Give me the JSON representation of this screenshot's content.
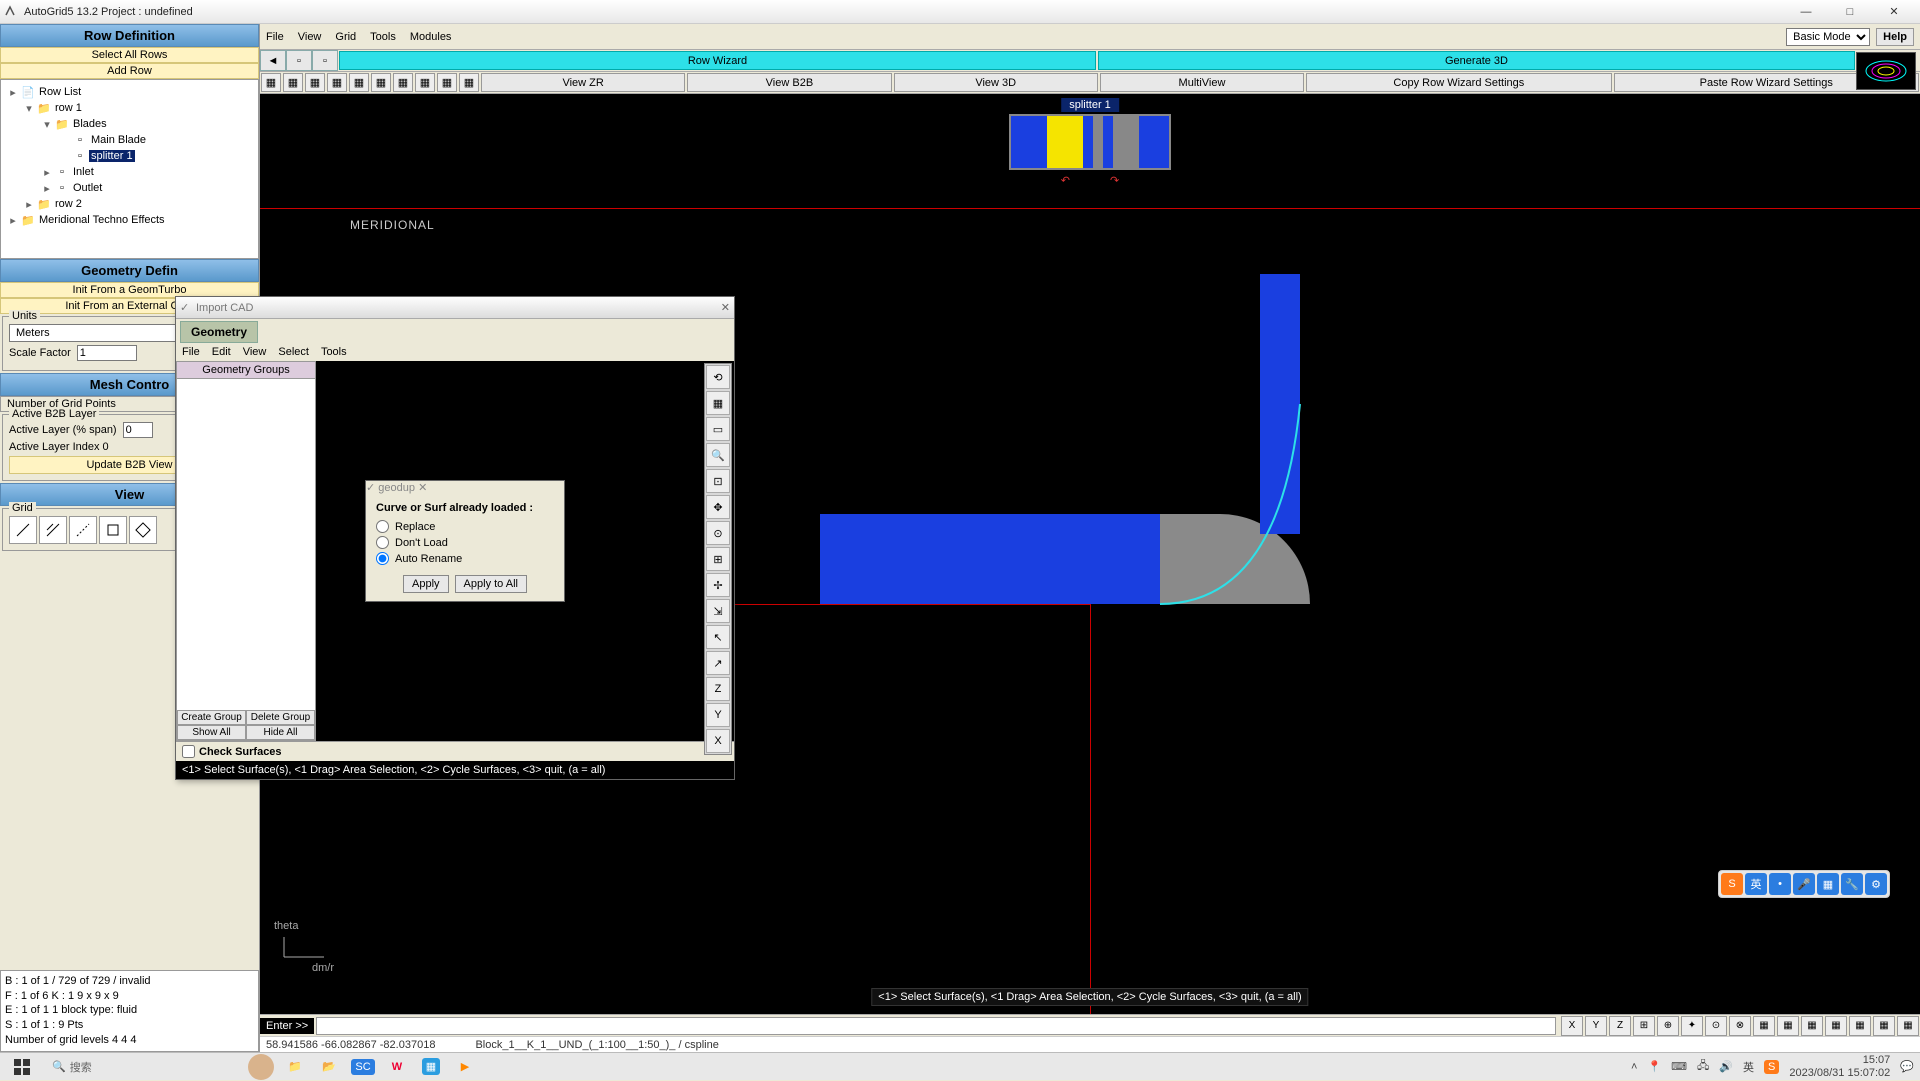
{
  "app": {
    "title": "AutoGrid5 13.2     Project : undefined"
  },
  "win_buttons": {
    "min": "—",
    "max": "□",
    "close": "✕"
  },
  "left": {
    "row_def_header": "Row Definition",
    "select_all": "Select All Rows",
    "add_row": "Add Row",
    "tree": {
      "row_list": "Row List",
      "row1": "row 1",
      "blades": "Blades",
      "main_blade": "Main Blade",
      "splitter1": "splitter 1",
      "inlet": "Inlet",
      "outlet": "Outlet",
      "row2": "row 2",
      "techno": "Meridional Techno Effects"
    },
    "geom_def_header": "Geometry Defin",
    "init_geom": "Init From a GeomTurbo",
    "init_cad": "Init From an External CAD",
    "units_legend": "Units",
    "units_value": "Meters",
    "scale_label": "Scale Factor",
    "scale_value": "1",
    "mesh_header": "Mesh Contro",
    "grid_points": "Number of Grid Points",
    "b2b_legend": "Active B2B Layer",
    "layer_span": "Active Layer (% span)",
    "layer_span_v": "0",
    "layer_index": "Active Layer Index 0",
    "update_b2b": "Update B2B View",
    "view_header": "View",
    "grid_legend": "Grid",
    "status": {
      "l1": "B : 1 of 1 / 729 of 729 / invalid",
      "l2": "F : 1 of 6    K : 1    9 x 9 x 9",
      "l3": "E : 1 of 1    1    block type: fluid",
      "l4": "S : 1 of 1 : 9 Pts",
      "l5": "Number of grid levels 4 4 4"
    }
  },
  "menu": {
    "file": "File",
    "view": "View",
    "grid": "Grid",
    "tools": "Tools",
    "modules": "Modules",
    "mode": "Basic Mode",
    "help": "Help"
  },
  "cyan": {
    "row_wizard": "Row Wizard",
    "generate_3d": "Generate 3D"
  },
  "viewbar": {
    "zr": "View ZR",
    "b2b": "View B2B",
    "v3d": "View 3D",
    "multi": "MultiView",
    "copy": "Copy Row Wizard Settings",
    "paste": "Paste Row Wizard Settings"
  },
  "canvas": {
    "splitter_tag": "splitter 1",
    "meridional": "MERIDIONAL",
    "theta": "theta",
    "dmr": "dm/r",
    "hint": "<1> Select Surface(s), <1 Drag> Area Selection, <2> Cycle Surfaces, <3> quit, (a = all)"
  },
  "import_cad": {
    "title": "Import CAD",
    "tab": "Geometry",
    "menu": {
      "file": "File",
      "edit": "Edit",
      "view": "View",
      "select": "Select",
      "tools": "Tools"
    },
    "groups_head": "Geometry Groups",
    "create_group": "Create Group",
    "delete_group": "Delete Group",
    "show_all": "Show All",
    "hide_all": "Hide All",
    "check_surfaces": "Check Surfaces",
    "hint": "<1> Select Surface(s), <1 Drag> Area Selection, <2> Cycle Surfaces, <3> quit, (a = all)"
  },
  "geodup": {
    "title": "geodup",
    "head": "Curve or Surf already loaded :",
    "opt1": "Replace",
    "opt2": "Don't Load",
    "opt3": "Auto Rename",
    "apply": "Apply",
    "apply_all": "Apply to All"
  },
  "footer": {
    "enter": "Enter >>",
    "coords": "58.941586  -66.082867  -82.037018",
    "block": "Block_1__K_1__UND_(_1:100__1:50_)_ / cspline"
  },
  "taskbar": {
    "search_placeholder": "搜索",
    "time": "15:07",
    "date": "2023/08/31 15:07:02",
    "ime": "英"
  }
}
